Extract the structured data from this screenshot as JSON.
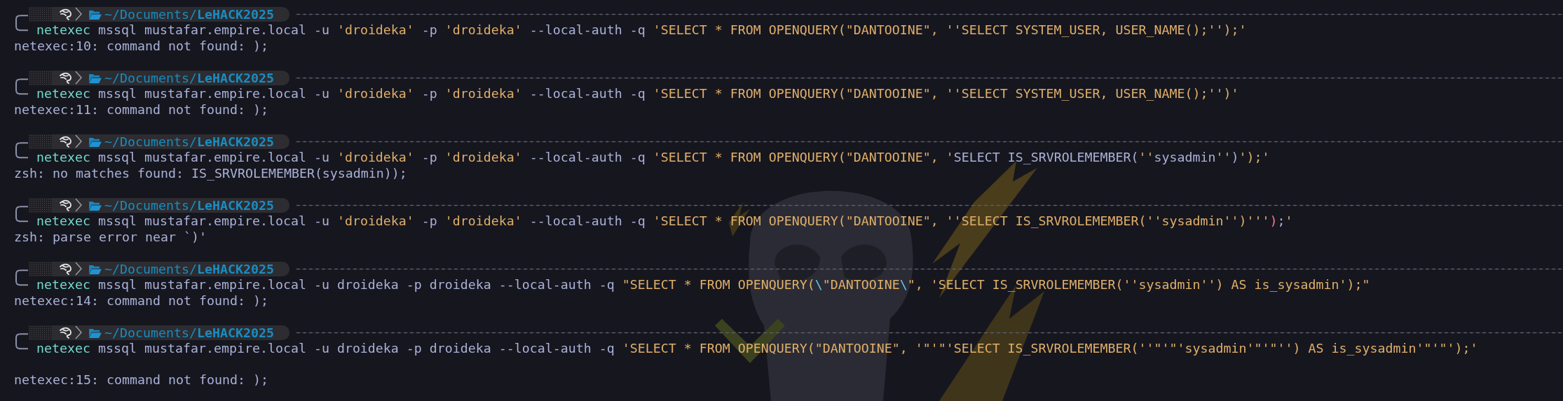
{
  "prompts": [
    {
      "path": "~/Documents/**LeHACK2025**",
      "command": [
        {
          "kind": "command",
          "text": "netexec"
        },
        {
          "kind": "plain",
          "text": " mssql mustafar.empire.local -u "
        },
        {
          "kind": "string",
          "text": "'droideka'"
        },
        {
          "kind": "plain",
          "text": " -p "
        },
        {
          "kind": "string",
          "text": "'droideka'"
        },
        {
          "kind": "plain",
          "text": " --local-auth -q "
        },
        {
          "kind": "string",
          "text": "'SELECT * FROM OPENQUERY(\"DANTOOINE\", ''SELECT SYSTEM_USER, USER_NAME();'');'"
        }
      ],
      "blank_before_output": false,
      "output": "netexec:10: command not found: );"
    },
    {
      "path": "~/Documents/**LeHACK2025**",
      "command": [
        {
          "kind": "command",
          "text": "netexec"
        },
        {
          "kind": "plain",
          "text": " mssql mustafar.empire.local -u "
        },
        {
          "kind": "string",
          "text": "'droideka'"
        },
        {
          "kind": "plain",
          "text": " -p "
        },
        {
          "kind": "string",
          "text": "'droideka'"
        },
        {
          "kind": "plain",
          "text": " --local-auth -q "
        },
        {
          "kind": "string",
          "text": "'SELECT * FROM OPENQUERY(\"DANTOOINE\", ''SELECT SYSTEM_USER, USER_NAME();'')'"
        }
      ],
      "blank_before_output": false,
      "output": "netexec:11: command not found: );"
    },
    {
      "path": "~/Documents/**LeHACK2025**",
      "command": [
        {
          "kind": "command",
          "text": "netexec"
        },
        {
          "kind": "plain",
          "text": " mssql mustafar.empire.local -u "
        },
        {
          "kind": "string",
          "text": "'droideka'"
        },
        {
          "kind": "plain",
          "text": " -p "
        },
        {
          "kind": "string",
          "text": "'droideka'"
        },
        {
          "kind": "plain",
          "text": " --local-auth -q "
        },
        {
          "kind": "string",
          "text": "'SELECT * FROM OPENQUERY(\"DANTOOINE\", '"
        },
        {
          "kind": "plain",
          "text": "SELECT IS_SRVROLEMEMBER("
        },
        {
          "kind": "string",
          "text": "''"
        },
        {
          "kind": "plain",
          "text": "sysadmin"
        },
        {
          "kind": "string",
          "text": "''"
        },
        {
          "kind": "plain",
          "text": ")"
        },
        {
          "kind": "string",
          "text": "');'"
        }
      ],
      "blank_before_output": false,
      "output": "zsh: no matches found: IS_SRVROLEMEMBER(sysadmin));"
    },
    {
      "path": "~/Documents/**LeHACK2025**",
      "command": [
        {
          "kind": "command",
          "text": "netexec"
        },
        {
          "kind": "plain",
          "text": " mssql mustafar.empire.local -u "
        },
        {
          "kind": "string",
          "text": "'droideka'"
        },
        {
          "kind": "plain",
          "text": " -p "
        },
        {
          "kind": "string",
          "text": "'droideka'"
        },
        {
          "kind": "plain",
          "text": " --local-auth -q "
        },
        {
          "kind": "string",
          "text": "'SELECT * FROM OPENQUERY(\"DANTOOINE\", ''SELECT IS_SRVROLEMEMBER(''sysadmin'')'''"
        },
        {
          "kind": "error",
          "text": ")"
        },
        {
          "kind": "plain",
          "text": ";"
        },
        {
          "kind": "string",
          "text": "'"
        }
      ],
      "blank_before_output": false,
      "output": "zsh: parse error near `)'"
    },
    {
      "path": "~/Documents/**LeHACK2025**",
      "command": [
        {
          "kind": "command",
          "text": "netexec"
        },
        {
          "kind": "plain",
          "text": " mssql mustafar.empire.local -u droideka -p droideka --local-auth -q "
        },
        {
          "kind": "string",
          "text": "\"SELECT * FROM OPENQUERY("
        },
        {
          "kind": "escape",
          "text": "\\"
        },
        {
          "kind": "string",
          "text": "\"DANTOOINE"
        },
        {
          "kind": "escape",
          "text": "\\"
        },
        {
          "kind": "string",
          "text": "\", 'SELECT IS_SRVROLEMEMBER(''sysadmin'') AS is_sysadmin');\""
        }
      ],
      "blank_before_output": false,
      "output": "netexec:14: command not found: );"
    },
    {
      "path": "~/Documents/**LeHACK2025**",
      "command": [
        {
          "kind": "command",
          "text": "netexec"
        },
        {
          "kind": "plain",
          "text": " mssql mustafar.empire.local -u droideka -p droideka --local-auth -q "
        },
        {
          "kind": "string",
          "text": "'SELECT * FROM OPENQUERY(\"DANTOOINE\", '\"'\"'SELECT IS_SRVROLEMEMBER(''\"'\"'sysadmin'\"'\"'') AS is_sysadmin'\"'\"');'"
        }
      ],
      "blank_before_output": true,
      "output": "netexec:15: command not found: );"
    }
  ]
}
